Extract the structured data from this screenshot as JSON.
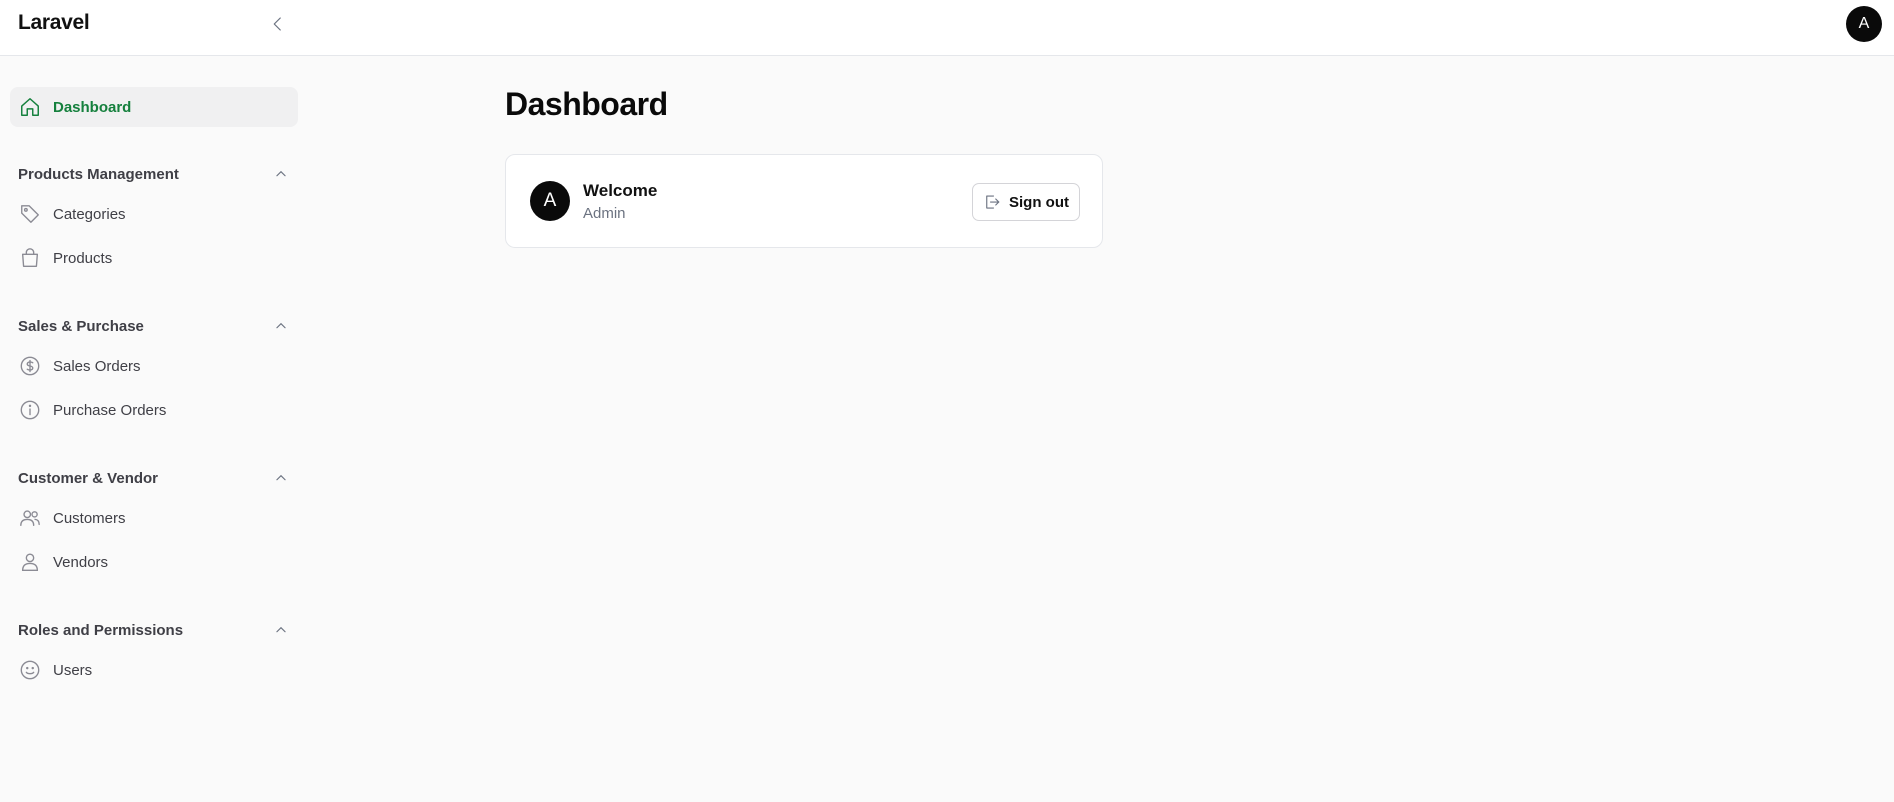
{
  "app": {
    "brand": "Laravel",
    "user_initial": "A"
  },
  "sidebar": {
    "dashboard": {
      "label": "Dashboard",
      "icon": "home-icon"
    },
    "groups": [
      {
        "title": "Products Management",
        "items": [
          {
            "label": "Categories",
            "icon": "tag-icon"
          },
          {
            "label": "Products",
            "icon": "shopping-bag-icon"
          }
        ]
      },
      {
        "title": "Sales & Purchase",
        "items": [
          {
            "label": "Sales Orders",
            "icon": "dollar-circle-icon"
          },
          {
            "label": "Purchase Orders",
            "icon": "info-circle-icon"
          }
        ]
      },
      {
        "title": "Customer & Vendor",
        "items": [
          {
            "label": "Customers",
            "icon": "users-icon"
          },
          {
            "label": "Vendors",
            "icon": "user-icon"
          }
        ]
      },
      {
        "title": "Roles and Permissions",
        "items": [
          {
            "label": "Users",
            "icon": "smile-icon"
          }
        ]
      }
    ]
  },
  "main": {
    "title": "Dashboard",
    "welcome": {
      "avatar_initial": "A",
      "title": "Welcome",
      "subtitle": "Admin",
      "signout_label": "Sign out"
    }
  },
  "colors": {
    "accent": "#15803d",
    "dark": "#0a0a0a",
    "background": "#fafafa"
  }
}
